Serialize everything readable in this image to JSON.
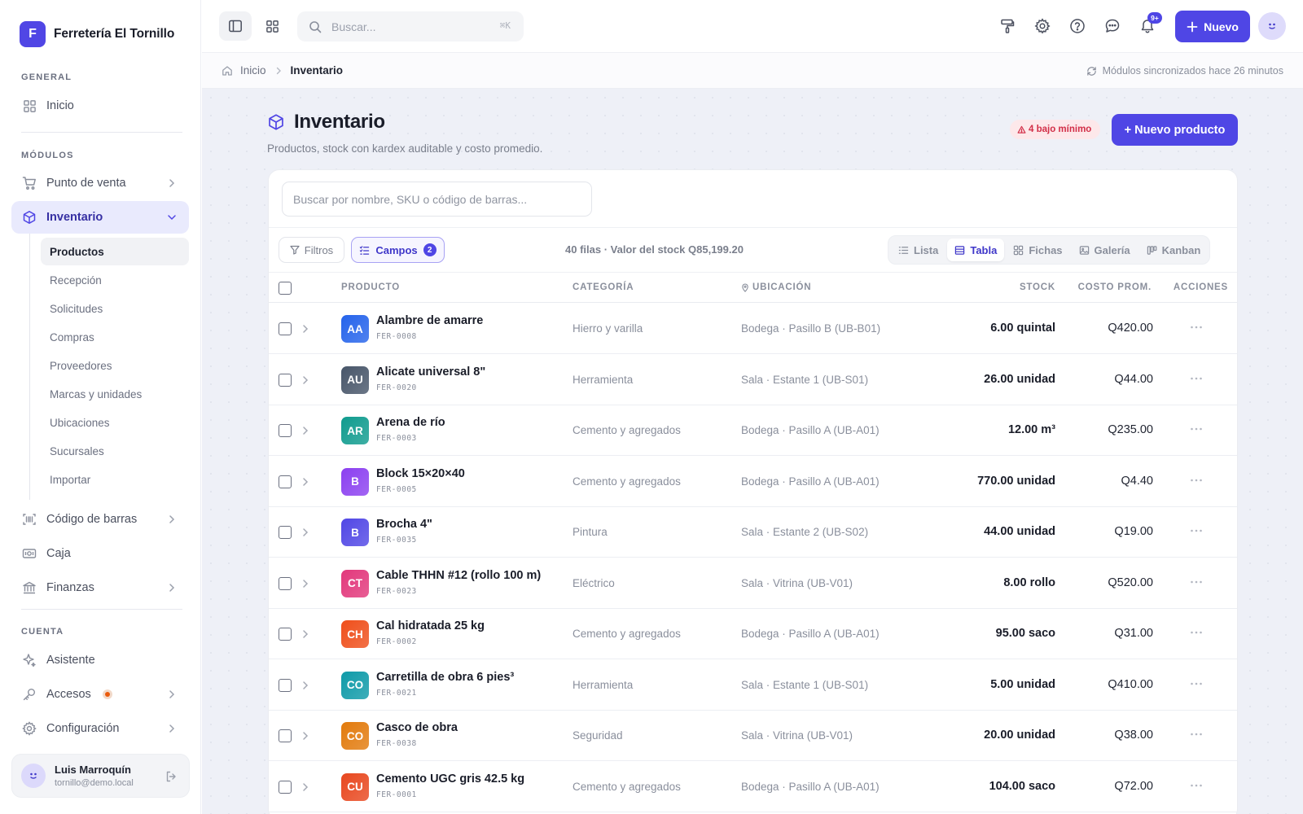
{
  "brand": {
    "initial": "F",
    "name": "Ferretería El Tornillo",
    "accent": "#5046e5"
  },
  "sidebar": {
    "general_label": "GENERAL",
    "inicio": "Inicio",
    "modulos_label": "MÓDULOS",
    "punto_de_venta": "Punto de venta",
    "inventario": "Inventario",
    "submenu": [
      "Productos",
      "Recepción",
      "Solicitudes",
      "Compras",
      "Proveedores",
      "Marcas y unidades",
      "Ubicaciones",
      "Sucursales",
      "Importar"
    ],
    "active_submenu": "Productos",
    "codigo_de_barras": "Código de barras",
    "caja": "Caja",
    "finanzas": "Finanzas",
    "cuenta_label": "CUENTA",
    "asistente": "Asistente",
    "accesos": "Accesos",
    "configuracion": "Configuración"
  },
  "user": {
    "name": "Luis Marroquín",
    "email": "tornillo@demo.local"
  },
  "topbar": {
    "search_placeholder": "Buscar...",
    "search_shortcut": "⌘K",
    "notifications_count": "9+",
    "new_button": "Nuevo"
  },
  "breadcrumb": {
    "home": "Inicio",
    "current": "Inventario",
    "sync_status": "Módulos sincronizados hace 26 minutos"
  },
  "page": {
    "title": "Inventario",
    "subtitle": "Productos, stock con kardex auditable y costo promedio.",
    "low_stock_badge": "4 bajo mínimo",
    "new_product_button": "+ Nuevo producto"
  },
  "table_tools": {
    "search_placeholder": "Buscar por nombre, SKU o código de barras...",
    "filters_label": "Filtros",
    "fields_label": "Campos",
    "fields_count": "2",
    "summary": "40 filas · Valor del stock Q85,199.20",
    "views": [
      "Lista",
      "Tabla",
      "Fichas",
      "Galería",
      "Kanban"
    ],
    "active_view": "Tabla"
  },
  "table": {
    "headers": {
      "producto": "PRODUCTO",
      "categoria": "CATEGORÍA",
      "ubicacion": "UBICACIÓN",
      "stock": "STOCK",
      "costo": "COSTO PROM.",
      "acciones": "ACCIONES"
    },
    "rows": [
      {
        "initials": "AA",
        "color": "#2563eb",
        "name": "Alambre de amarre",
        "sku": "FER-0008",
        "category": "Hierro y varilla",
        "location": "Bodega · Pasillo B (UB-B01)",
        "stock": "6.00 quintal",
        "cost": "Q420.00"
      },
      {
        "initials": "AU",
        "color": "#475569",
        "name": "Alicate universal 8\"",
        "sku": "FER-0020",
        "category": "Herramienta",
        "location": "Sala · Estante 1 (UB-S01)",
        "stock": "26.00 unidad",
        "cost": "Q44.00"
      },
      {
        "initials": "AR",
        "color": "#0f9b8e",
        "name": "Arena de río",
        "sku": "FER-0003",
        "category": "Cemento y agregados",
        "location": "Bodega · Pasillo A (UB-A01)",
        "stock": "12.00 m³",
        "cost": "Q235.00"
      },
      {
        "initials": "B",
        "color": "#8b3ff0",
        "name": "Block 15×20×40",
        "sku": "FER-0005",
        "category": "Cemento y agregados",
        "location": "Bodega · Pasillo A (UB-A01)",
        "stock": "770.00 unidad",
        "cost": "Q4.40"
      },
      {
        "initials": "B",
        "color": "#5046e5",
        "name": "Brocha 4\"",
        "sku": "FER-0035",
        "category": "Pintura",
        "location": "Sala · Estante 2 (UB-S02)",
        "stock": "44.00 unidad",
        "cost": "Q19.00"
      },
      {
        "initials": "CT",
        "color": "#e2377b",
        "name": "Cable THHN #12 (rollo 100 m)",
        "sku": "FER-0023",
        "category": "Eléctrico",
        "location": "Sala · Vitrina (UB-V01)",
        "stock": "8.00 rollo",
        "cost": "Q520.00"
      },
      {
        "initials": "CH",
        "color": "#ef4e1a",
        "name": "Cal hidratada 25 kg",
        "sku": "FER-0002",
        "category": "Cemento y agregados",
        "location": "Bodega · Pasillo A (UB-A01)",
        "stock": "95.00 saco",
        "cost": "Q31.00"
      },
      {
        "initials": "CO",
        "color": "#0e9aa8",
        "name": "Carretilla de obra 6 pies³",
        "sku": "FER-0021",
        "category": "Herramienta",
        "location": "Sala · Estante 1 (UB-S01)",
        "stock": "5.00 unidad",
        "cost": "Q410.00"
      },
      {
        "initials": "CO",
        "color": "#e27a0c",
        "name": "Casco de obra",
        "sku": "FER-0038",
        "category": "Seguridad",
        "location": "Sala · Vitrina (UB-V01)",
        "stock": "20.00 unidad",
        "cost": "Q38.00"
      },
      {
        "initials": "CU",
        "color": "#e8471e",
        "name": "Cemento UGC gris 42.5 kg",
        "sku": "FER-0001",
        "category": "Cemento y agregados",
        "location": "Bodega · Pasillo A (UB-A01)",
        "stock": "104.00 saco",
        "cost": "Q72.00"
      }
    ]
  }
}
